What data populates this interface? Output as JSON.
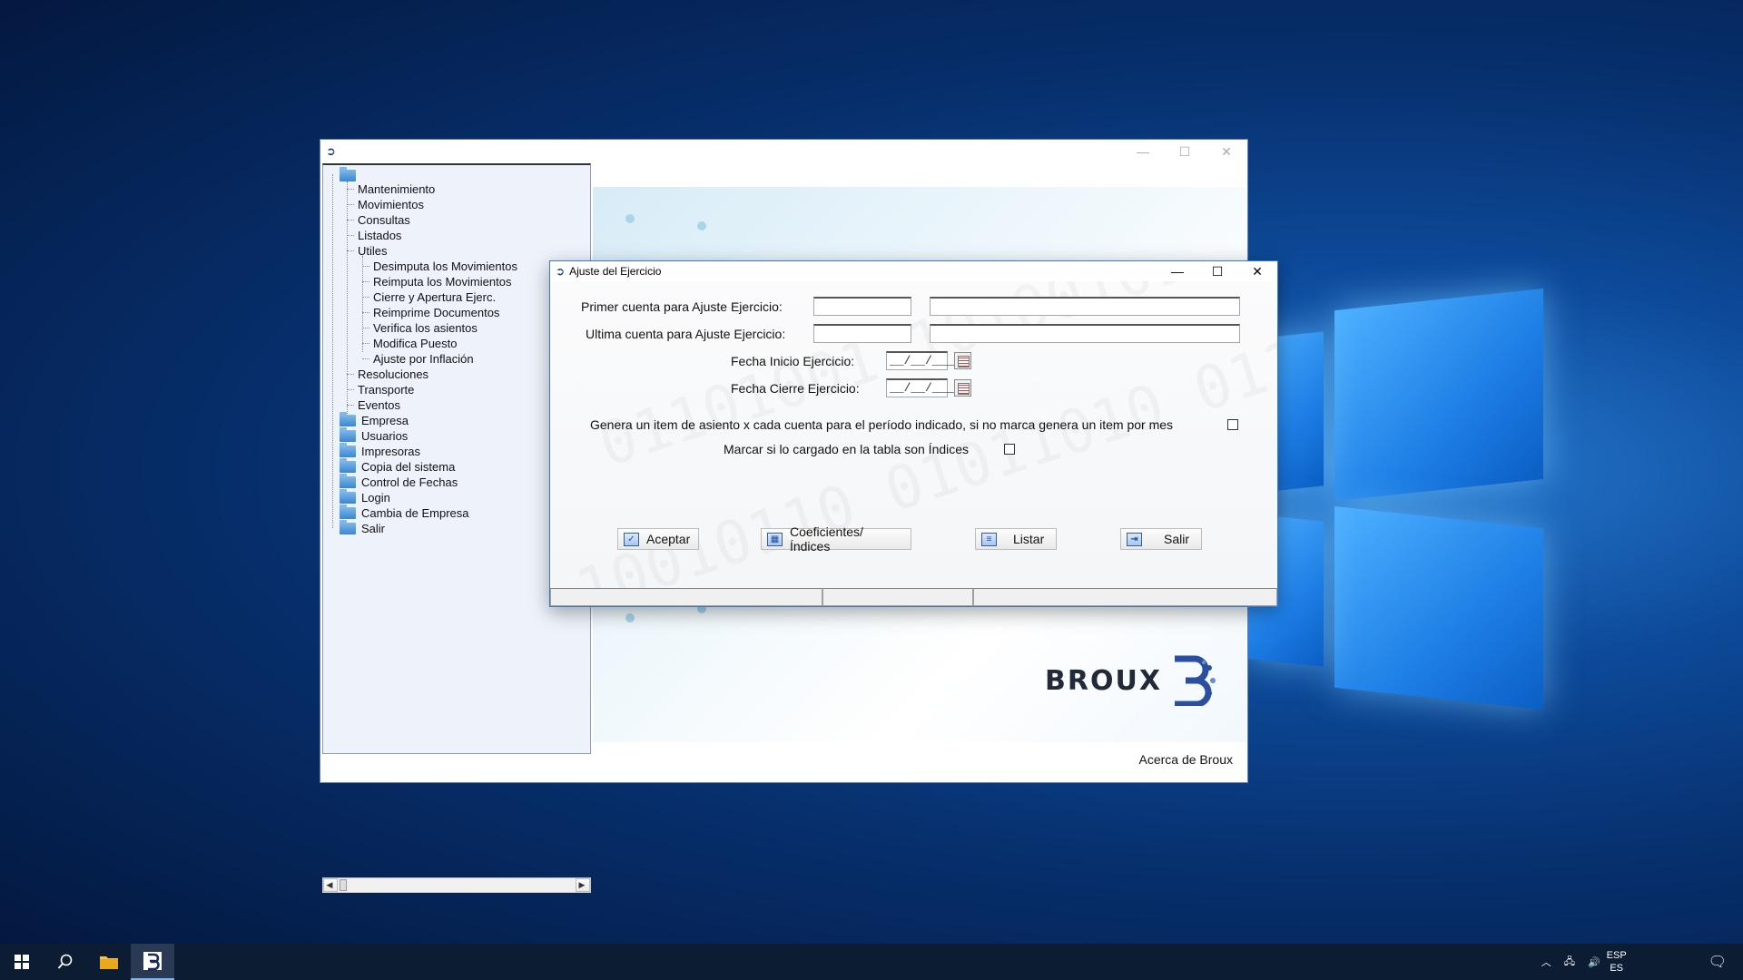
{
  "app_window": {
    "tree": {
      "root_children": [
        {
          "label": "Mantenimiento"
        },
        {
          "label": "Movimientos"
        },
        {
          "label": "Consultas"
        },
        {
          "label": "Listados"
        },
        {
          "label": "Utiles"
        }
      ],
      "utiles_children": [
        {
          "label": "Desimputa los Movimientos"
        },
        {
          "label": "Reimputa los Movimientos"
        },
        {
          "label": "Cierre y Apertura Ejerc."
        },
        {
          "label": "Reimprime Documentos"
        },
        {
          "label": "Verifica los asientos"
        },
        {
          "label": "Modifica Puesto"
        },
        {
          "label": "Ajuste por Inflación"
        }
      ],
      "after_utiles": [
        {
          "label": "Resoluciones"
        },
        {
          "label": "Transporte"
        },
        {
          "label": "Eventos"
        }
      ],
      "folders": [
        {
          "label": "Empresa"
        },
        {
          "label": "Usuarios"
        },
        {
          "label": "Impresoras"
        },
        {
          "label": "Copia del sistema"
        },
        {
          "label": "Control de Fechas"
        },
        {
          "label": "Login"
        },
        {
          "label": "Cambia de Empresa"
        },
        {
          "label": "Salir"
        }
      ]
    },
    "logo_text": "BROUX",
    "about_link": "Acerca de Broux"
  },
  "dialog": {
    "title": "Ajuste del Ejercicio",
    "fields": {
      "primer_cuenta_label": "Primer cuenta para Ajuste Ejercicio:",
      "ultima_cuenta_label": "Ultima cuenta para Ajuste Ejercicio:",
      "fecha_inicio_label": "Fecha Inicio Ejercicio:",
      "fecha_cierre_label": "Fecha Cierre Ejercicio:",
      "date_mask": "__/__/____",
      "primer_cuenta_value": "",
      "ultima_cuenta_value": ""
    },
    "checkboxes": {
      "genera_item_label": "Genera un item de asiento x cada cuenta para el período indicado,  si no marca genera un item por mes",
      "genera_item_checked": false,
      "indices_label": "Marcar si lo cargado en la tabla son Índices",
      "indices_checked": false
    },
    "buttons": {
      "aceptar": "Aceptar",
      "coeficientes": "Coeficientes/Índices",
      "listar": "Listar",
      "salir": "Salir"
    }
  },
  "taskbar": {
    "lang_top": "ESP",
    "lang_bottom": "ES"
  },
  "colors": {
    "accent": "#3b78c4",
    "tree_bg": "#edf2fb",
    "taskbar": "#0c1c33"
  }
}
